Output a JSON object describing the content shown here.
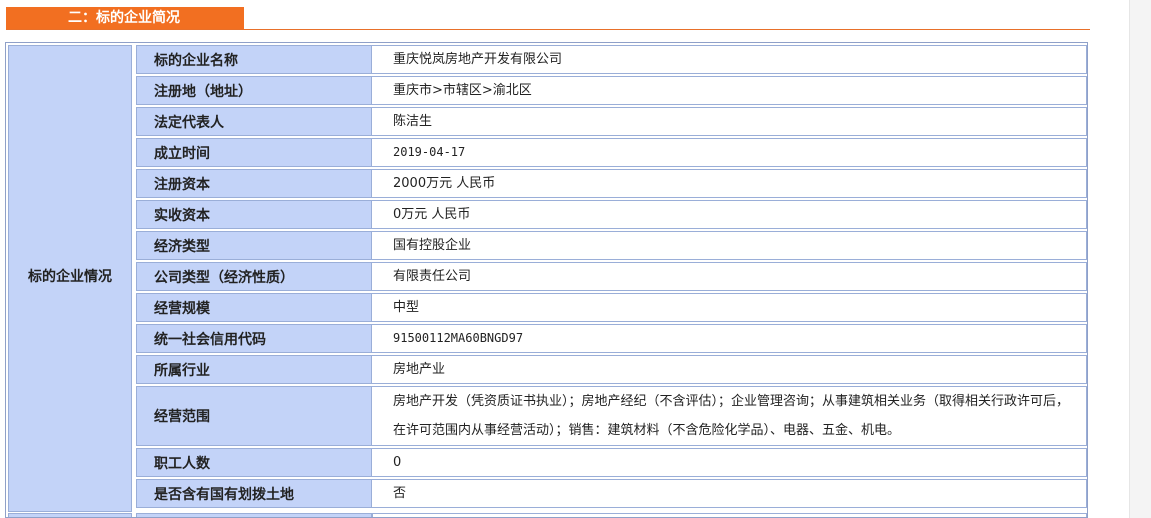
{
  "section": {
    "title": "二：标的企业简况"
  },
  "group": {
    "label": "标的企业情况"
  },
  "rows": [
    {
      "label": "标的企业名称",
      "value": "重庆悦岚房地产开发有限公司"
    },
    {
      "label": "注册地（地址）",
      "value": "重庆市>市辖区>渝北区"
    },
    {
      "label": "法定代表人",
      "value": "陈洁生"
    },
    {
      "label": "成立时间",
      "value": "2019-04-17"
    },
    {
      "label": "注册资本",
      "value": "2000万元 人民币"
    },
    {
      "label": "实收资本",
      "value": "0万元 人民币"
    },
    {
      "label": "经济类型",
      "value": "国有控股企业"
    },
    {
      "label": "公司类型（经济性质）",
      "value": "有限责任公司"
    },
    {
      "label": "经营规模",
      "value": "中型"
    },
    {
      "label": "统一社会信用代码",
      "value": "91500112MA60BNGD97"
    },
    {
      "label": "所属行业",
      "value": "房地产业"
    },
    {
      "label": "经营范围",
      "value": "房地产开发（凭资质证书执业）；房地产经纪（不含评估）；企业管理咨询；从事建筑相关业务（取得相关行政许可后，在许可范围内从事经营活动）；销售：建筑材料（不含危险化学品）、电器、五金、机电。"
    },
    {
      "label": "职工人数",
      "value": "0"
    },
    {
      "label": "是否含有国有划拨土地",
      "value": "否"
    }
  ]
}
